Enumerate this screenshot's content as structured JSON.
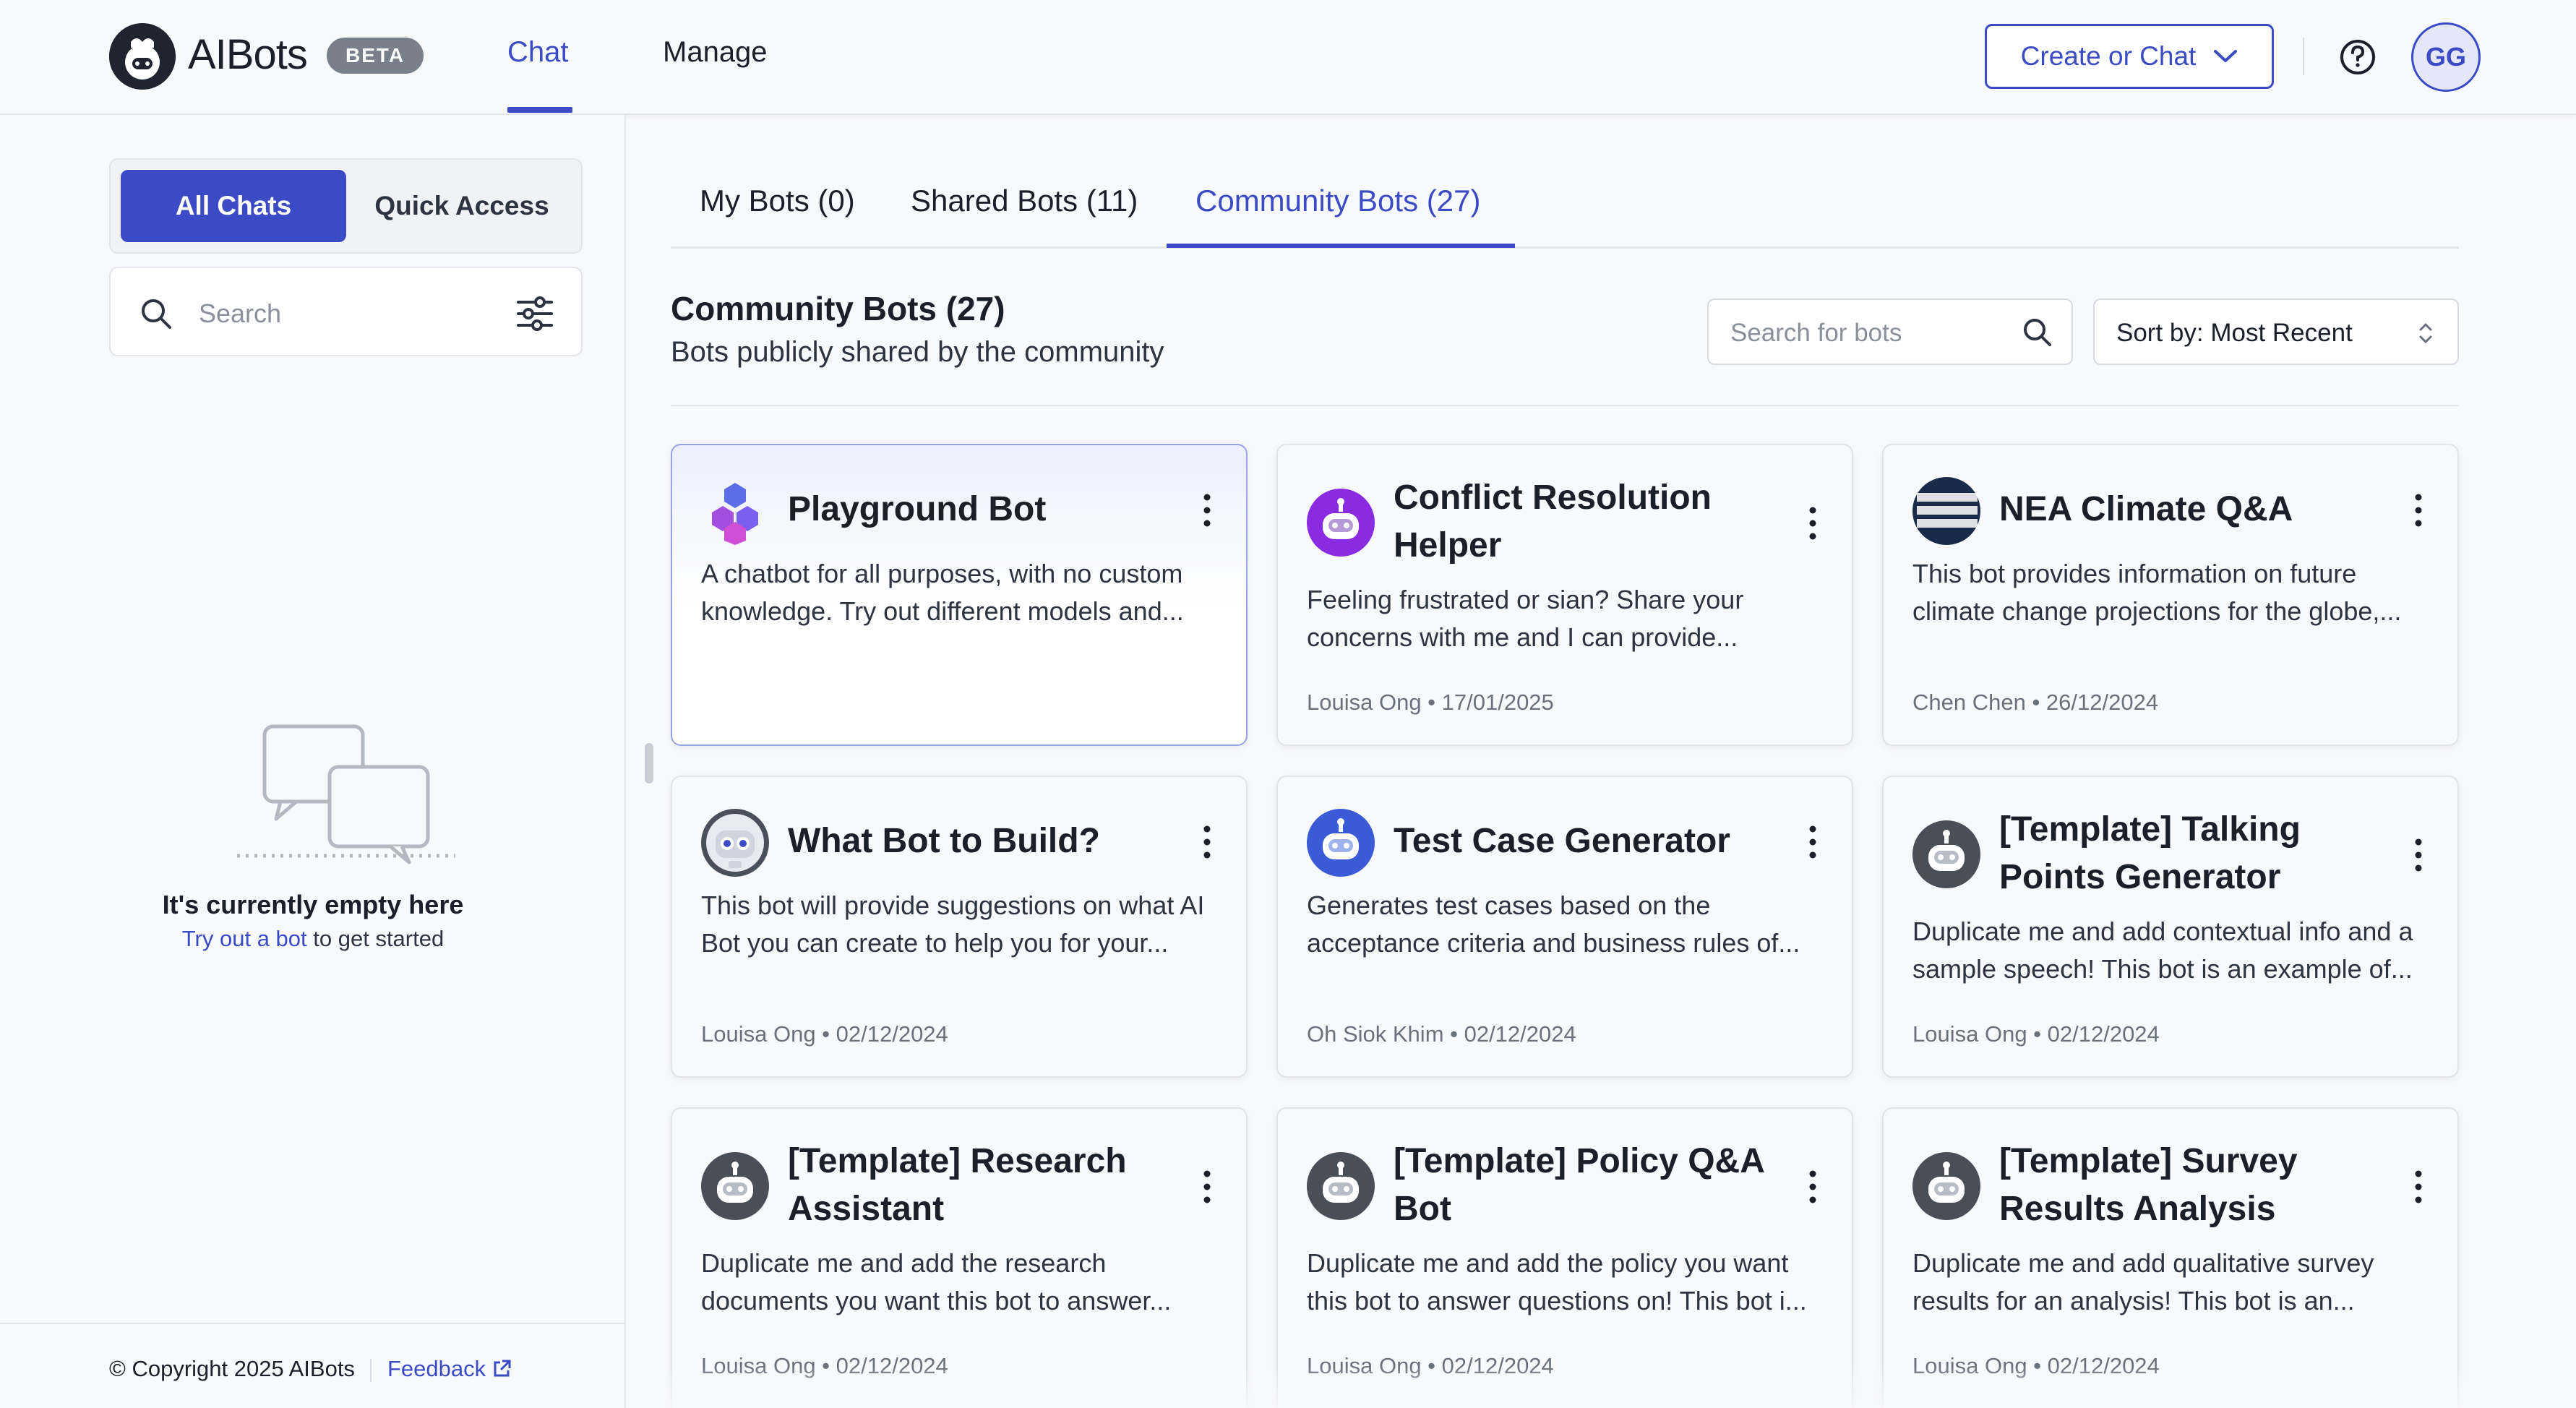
{
  "header": {
    "app_name": "AIBots",
    "badge": "BETA",
    "nav": [
      "Chat",
      "Manage"
    ],
    "active_nav": "Chat",
    "create_button": "Create or Chat",
    "avatar_initials": "GG"
  },
  "sidebar": {
    "segment": [
      "All Chats",
      "Quick Access"
    ],
    "search_placeholder": "Search",
    "empty_title": "It's currently empty here",
    "empty_link": "Try out a bot",
    "empty_suffix": " to get started",
    "copyright": "© Copyright 2025 AIBots",
    "feedback": "Feedback"
  },
  "main": {
    "tabs": [
      "My Bots (0)",
      "Shared Bots (11)",
      "Community Bots (27)"
    ],
    "active_tab": "Community Bots (27)",
    "section_title": "Community Bots (27)",
    "section_subtitle": "Bots publicly shared by the community",
    "search_placeholder": "Search for bots",
    "sort_label": "Sort by: Most Recent",
    "cards": [
      {
        "title": "Playground Bot",
        "description": "A chatbot for all purposes, with no custom knowledge. Try out different models and...",
        "meta": "",
        "icon": "cubes-icon"
      },
      {
        "title": "Conflict Resolution Helper",
        "description": "Feeling frustrated or sian? Share your concerns with me and I can provide...",
        "meta": "Louisa Ong • 17/01/2025",
        "icon": "purple-robot-icon"
      },
      {
        "title": "NEA Climate Q&A",
        "description": "This bot provides information on future climate change projections for the globe,...",
        "meta": "Chen Chen • 26/12/2024",
        "icon": "meteorological-service-logo"
      },
      {
        "title": "What Bot to Build?",
        "description": "This bot will provide suggestions on what AI Bot you can create to help you for your...",
        "meta": "Louisa Ong • 02/12/2024",
        "icon": "cute-robot-icon"
      },
      {
        "title": "Test Case Generator",
        "description": "Generates test cases based on the acceptance criteria and business rules of...",
        "meta": "Oh Siok Khim • 02/12/2024",
        "icon": "blue-robot-icon"
      },
      {
        "title": "[Template] Talking Points Generator",
        "description": "Duplicate me and add contextual info and a sample speech! This bot is an example of...",
        "meta": "Louisa Ong • 02/12/2024",
        "icon": "robot-icon"
      },
      {
        "title": "[Template] Research Assistant",
        "description": "Duplicate me and add the research documents you want this bot to answer...",
        "meta": "Louisa Ong • 02/12/2024",
        "icon": "robot-icon"
      },
      {
        "title": "[Template] Policy Q&A Bot",
        "description": "Duplicate me and add the policy you want this bot to answer questions on! This bot i...",
        "meta": "Louisa Ong • 02/12/2024",
        "icon": "robot-icon"
      },
      {
        "title": "[Template] Survey Results Analysis",
        "description": "Duplicate me and add qualitative survey results for an analysis! This bot is an...",
        "meta": "Louisa Ong • 02/12/2024",
        "icon": "robot-icon"
      }
    ]
  },
  "colors": {
    "accent": "#3b4bc6",
    "background": "#f8f9fb",
    "border": "#e3e5ea"
  }
}
